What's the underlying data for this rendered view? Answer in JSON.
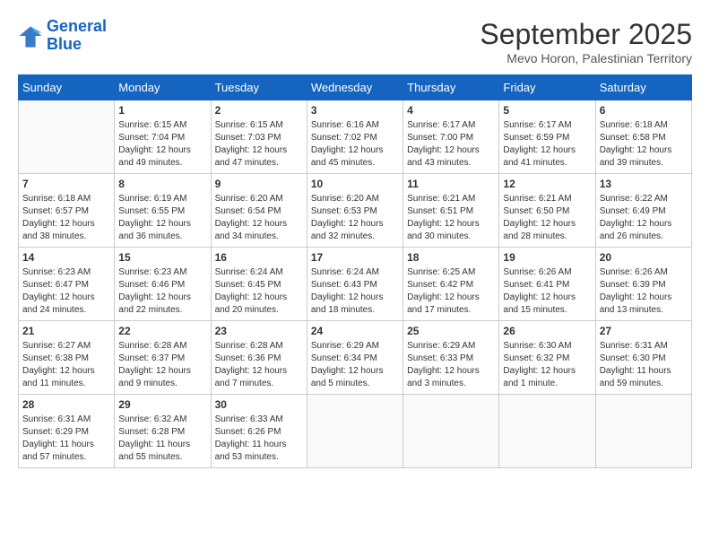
{
  "logo": {
    "line1": "General",
    "line2": "Blue"
  },
  "title": "September 2025",
  "location": "Mevo Horon, Palestinian Territory",
  "days_of_week": [
    "Sunday",
    "Monday",
    "Tuesday",
    "Wednesday",
    "Thursday",
    "Friday",
    "Saturday"
  ],
  "weeks": [
    [
      {
        "day": "",
        "info": ""
      },
      {
        "day": "1",
        "info": "Sunrise: 6:15 AM\nSunset: 7:04 PM\nDaylight: 12 hours\nand 49 minutes."
      },
      {
        "day": "2",
        "info": "Sunrise: 6:15 AM\nSunset: 7:03 PM\nDaylight: 12 hours\nand 47 minutes."
      },
      {
        "day": "3",
        "info": "Sunrise: 6:16 AM\nSunset: 7:02 PM\nDaylight: 12 hours\nand 45 minutes."
      },
      {
        "day": "4",
        "info": "Sunrise: 6:17 AM\nSunset: 7:00 PM\nDaylight: 12 hours\nand 43 minutes."
      },
      {
        "day": "5",
        "info": "Sunrise: 6:17 AM\nSunset: 6:59 PM\nDaylight: 12 hours\nand 41 minutes."
      },
      {
        "day": "6",
        "info": "Sunrise: 6:18 AM\nSunset: 6:58 PM\nDaylight: 12 hours\nand 39 minutes."
      }
    ],
    [
      {
        "day": "7",
        "info": "Sunrise: 6:18 AM\nSunset: 6:57 PM\nDaylight: 12 hours\nand 38 minutes."
      },
      {
        "day": "8",
        "info": "Sunrise: 6:19 AM\nSunset: 6:55 PM\nDaylight: 12 hours\nand 36 minutes."
      },
      {
        "day": "9",
        "info": "Sunrise: 6:20 AM\nSunset: 6:54 PM\nDaylight: 12 hours\nand 34 minutes."
      },
      {
        "day": "10",
        "info": "Sunrise: 6:20 AM\nSunset: 6:53 PM\nDaylight: 12 hours\nand 32 minutes."
      },
      {
        "day": "11",
        "info": "Sunrise: 6:21 AM\nSunset: 6:51 PM\nDaylight: 12 hours\nand 30 minutes."
      },
      {
        "day": "12",
        "info": "Sunrise: 6:21 AM\nSunset: 6:50 PM\nDaylight: 12 hours\nand 28 minutes."
      },
      {
        "day": "13",
        "info": "Sunrise: 6:22 AM\nSunset: 6:49 PM\nDaylight: 12 hours\nand 26 minutes."
      }
    ],
    [
      {
        "day": "14",
        "info": "Sunrise: 6:23 AM\nSunset: 6:47 PM\nDaylight: 12 hours\nand 24 minutes."
      },
      {
        "day": "15",
        "info": "Sunrise: 6:23 AM\nSunset: 6:46 PM\nDaylight: 12 hours\nand 22 minutes."
      },
      {
        "day": "16",
        "info": "Sunrise: 6:24 AM\nSunset: 6:45 PM\nDaylight: 12 hours\nand 20 minutes."
      },
      {
        "day": "17",
        "info": "Sunrise: 6:24 AM\nSunset: 6:43 PM\nDaylight: 12 hours\nand 18 minutes."
      },
      {
        "day": "18",
        "info": "Sunrise: 6:25 AM\nSunset: 6:42 PM\nDaylight: 12 hours\nand 17 minutes."
      },
      {
        "day": "19",
        "info": "Sunrise: 6:26 AM\nSunset: 6:41 PM\nDaylight: 12 hours\nand 15 minutes."
      },
      {
        "day": "20",
        "info": "Sunrise: 6:26 AM\nSunset: 6:39 PM\nDaylight: 12 hours\nand 13 minutes."
      }
    ],
    [
      {
        "day": "21",
        "info": "Sunrise: 6:27 AM\nSunset: 6:38 PM\nDaylight: 12 hours\nand 11 minutes."
      },
      {
        "day": "22",
        "info": "Sunrise: 6:28 AM\nSunset: 6:37 PM\nDaylight: 12 hours\nand 9 minutes."
      },
      {
        "day": "23",
        "info": "Sunrise: 6:28 AM\nSunset: 6:36 PM\nDaylight: 12 hours\nand 7 minutes."
      },
      {
        "day": "24",
        "info": "Sunrise: 6:29 AM\nSunset: 6:34 PM\nDaylight: 12 hours\nand 5 minutes."
      },
      {
        "day": "25",
        "info": "Sunrise: 6:29 AM\nSunset: 6:33 PM\nDaylight: 12 hours\nand 3 minutes."
      },
      {
        "day": "26",
        "info": "Sunrise: 6:30 AM\nSunset: 6:32 PM\nDaylight: 12 hours\nand 1 minute."
      },
      {
        "day": "27",
        "info": "Sunrise: 6:31 AM\nSunset: 6:30 PM\nDaylight: 11 hours\nand 59 minutes."
      }
    ],
    [
      {
        "day": "28",
        "info": "Sunrise: 6:31 AM\nSunset: 6:29 PM\nDaylight: 11 hours\nand 57 minutes."
      },
      {
        "day": "29",
        "info": "Sunrise: 6:32 AM\nSunset: 6:28 PM\nDaylight: 11 hours\nand 55 minutes."
      },
      {
        "day": "30",
        "info": "Sunrise: 6:33 AM\nSunset: 6:26 PM\nDaylight: 11 hours\nand 53 minutes."
      },
      {
        "day": "",
        "info": ""
      },
      {
        "day": "",
        "info": ""
      },
      {
        "day": "",
        "info": ""
      },
      {
        "day": "",
        "info": ""
      }
    ]
  ]
}
